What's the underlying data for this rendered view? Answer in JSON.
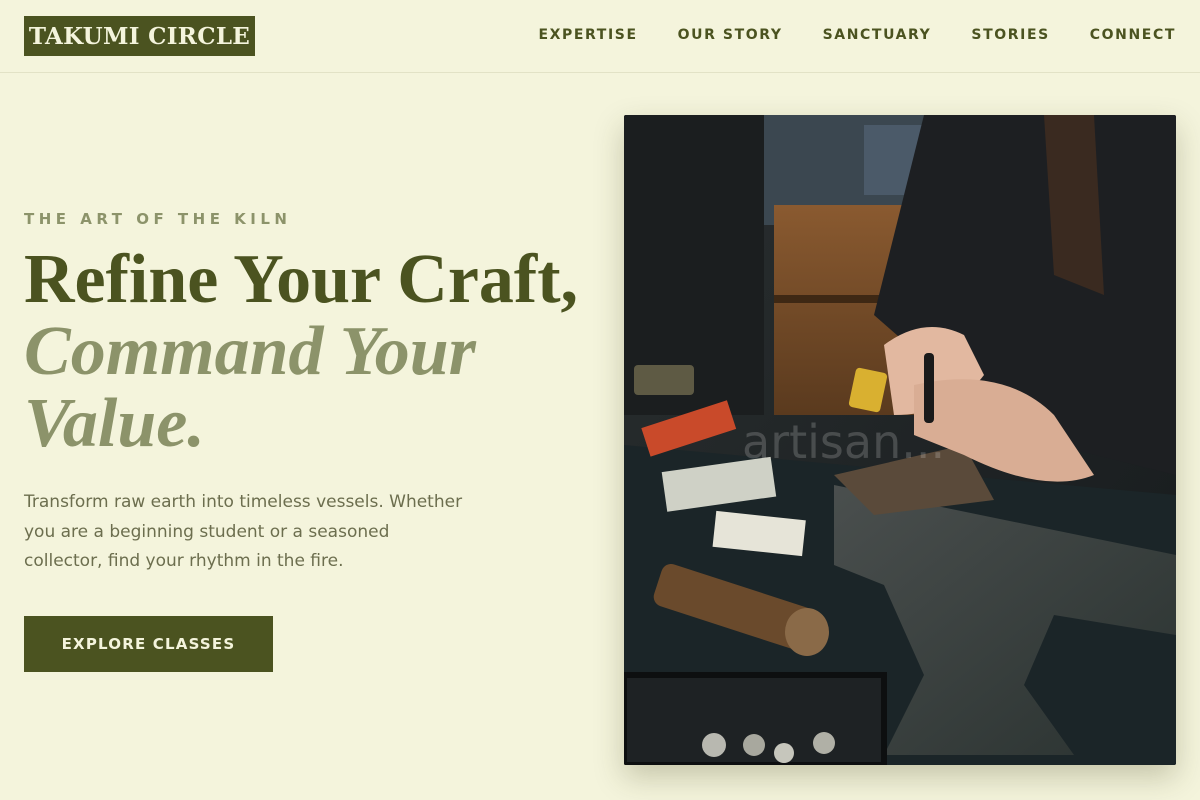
{
  "brand": {
    "logo": "TAKUMI CIRCLE"
  },
  "nav": {
    "items": [
      "EXPERTISE",
      "OUR STORY",
      "SANCTUARY",
      "STORIES",
      "CONNECT"
    ]
  },
  "hero": {
    "eyebrow": "THE ART OF THE KILN",
    "headline_line1": "Refine Your Craft,",
    "headline_line2": "Command Your",
    "headline_line3": "Value.",
    "description": "Transform raw earth into timeless vessels. Whether you are a beginning student or a seasoned collector, find your rhythm in the fire.",
    "cta_label": "EXPLORE CLASSES",
    "image_watermark": "artisan..."
  },
  "colors": {
    "background": "#f4f4dc",
    "accent": "#4b5320",
    "muted": "#8c936a"
  }
}
